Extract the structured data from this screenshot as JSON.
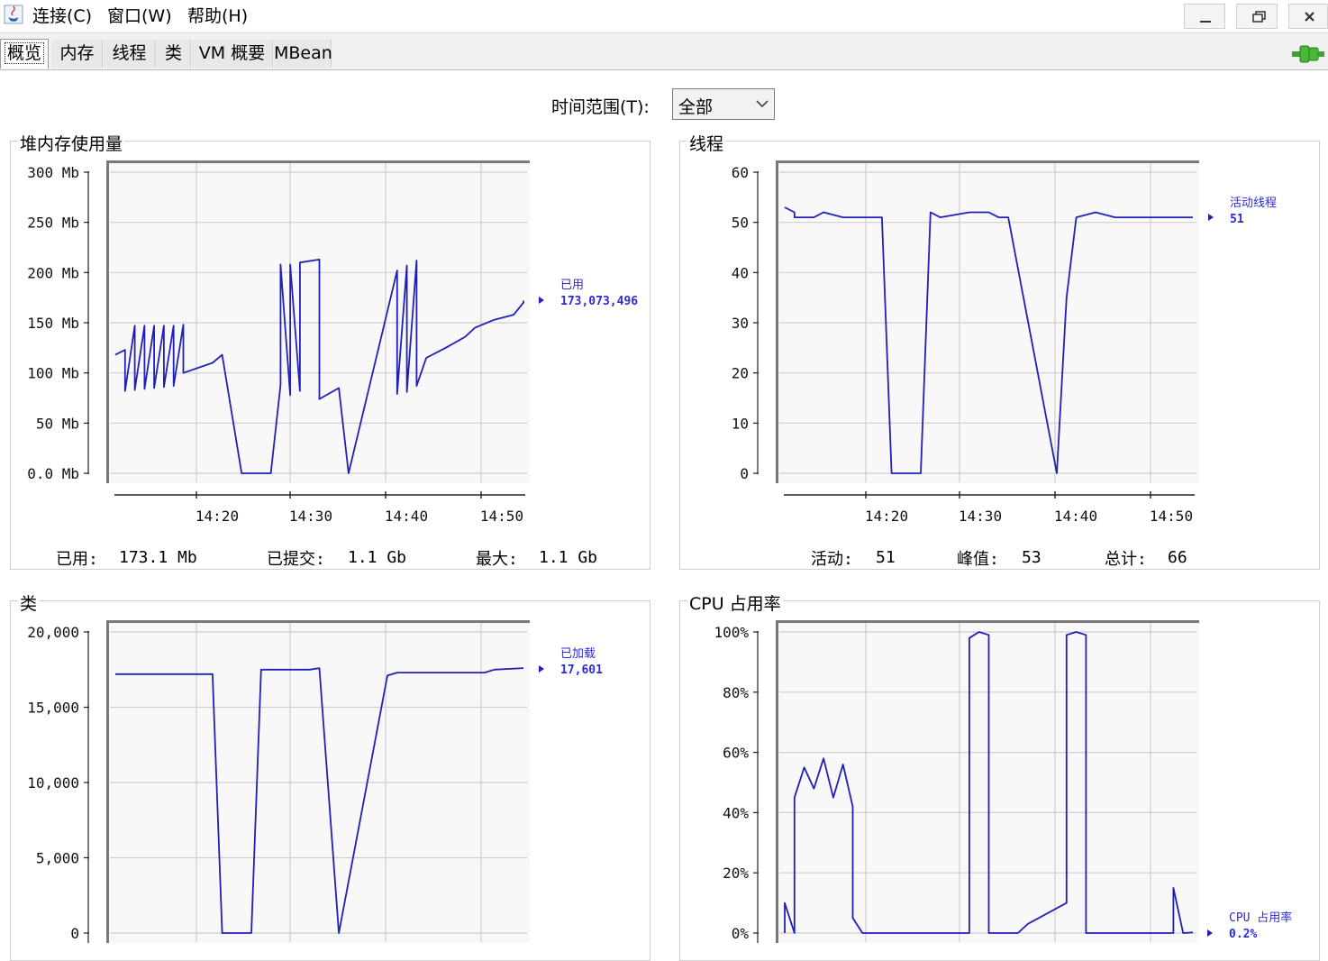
{
  "menu": {
    "connect": "连接(C)",
    "window": "窗口(W)",
    "help": "帮助(H)"
  },
  "tabs": [
    "概览",
    "内存",
    "线程",
    "类",
    "VM 概要",
    "MBean"
  ],
  "time_range": {
    "label": "时间范围(T):",
    "value": "全部"
  },
  "panels": {
    "heap": {
      "title": "堆内存使用量",
      "legend": {
        "name": "已用",
        "value": "173,073,496"
      },
      "stats": {
        "used_label": "已用:",
        "used_value": "173.1 Mb",
        "committed_label": "已提交:",
        "committed_value": "1.1 Gb",
        "max_label": "最大:",
        "max_value": "1.1 Gb"
      }
    },
    "threads": {
      "title": "线程",
      "legend": {
        "name": "活动线程",
        "value": "51"
      },
      "stats": {
        "live_label": "活动:",
        "live_value": "51",
        "peak_label": "峰值:",
        "peak_value": "53",
        "total_label": "总计:",
        "total_value": "66"
      }
    },
    "classes": {
      "title": "类",
      "legend": {
        "name": "已加载",
        "value": "17,601"
      }
    },
    "cpu": {
      "title": "CPU 占用率",
      "legend": {
        "name": "CPU 占用率",
        "value": "0.2%"
      }
    }
  },
  "chart_data": [
    {
      "type": "line",
      "title": "堆内存使用量",
      "ylim": [
        0,
        300
      ],
      "yticks": [
        "0.0 Mb",
        "50 Mb",
        "100 Mb",
        "150 Mb",
        "200 Mb",
        "250 Mb",
        "300 Mb"
      ],
      "xticks": [
        "14:20",
        "14:30",
        "14:40",
        "14:50"
      ],
      "series": [
        {
          "name": "已用",
          "points": [
            [
              "14:11",
              118
            ],
            [
              "14:12",
              123
            ],
            [
              "14:12",
              82
            ],
            [
              "14:13",
              147
            ],
            [
              "14:13",
              83
            ],
            [
              "14:14",
              147
            ],
            [
              "14:14",
              84
            ],
            [
              "14:15",
              147
            ],
            [
              "14:15",
              85
            ],
            [
              "14:16",
              147
            ],
            [
              "14:16",
              86
            ],
            [
              "14:17",
              147
            ],
            [
              "14:17",
              87
            ],
            [
              "14:18",
              148
            ],
            [
              "14:18",
              100
            ],
            [
              "14:21",
              110
            ],
            [
              "14:22",
              118
            ],
            [
              "14:24",
              0
            ],
            [
              "14:27",
              0
            ],
            [
              "14:28",
              88
            ],
            [
              "14:28",
              208
            ],
            [
              "14:29",
              78
            ],
            [
              "14:29",
              208
            ],
            [
              "14:30",
              82
            ],
            [
              "14:30",
              210
            ],
            [
              "14:32",
              213
            ],
            [
              "14:32",
              74
            ],
            [
              "14:34",
              85
            ],
            [
              "14:35",
              0
            ],
            [
              "14:40",
              202
            ],
            [
              "14:40",
              79
            ],
            [
              "14:41",
              207
            ],
            [
              "14:41",
              81
            ],
            [
              "14:42",
              212
            ],
            [
              "14:42",
              87
            ],
            [
              "14:43",
              115
            ],
            [
              "14:45",
              125
            ],
            [
              "14:47",
              136
            ],
            [
              "14:48",
              145
            ],
            [
              "14:50",
              153
            ],
            [
              "14:52",
              158
            ],
            [
              "14:53",
              170
            ],
            [
              "14:53",
              172
            ]
          ]
        }
      ]
    },
    {
      "type": "line",
      "title": "线程",
      "ylim": [
        0,
        60
      ],
      "yticks": [
        "0",
        "10",
        "20",
        "30",
        "40",
        "50",
        "60"
      ],
      "xticks": [
        "14:20",
        "14:30",
        "14:40",
        "14:50"
      ],
      "series": [
        {
          "name": "活动线程",
          "points": [
            [
              "14:11",
              53
            ],
            [
              "14:12",
              52
            ],
            [
              "14:12",
              51
            ],
            [
              "14:14",
              51
            ],
            [
              "14:15",
              52
            ],
            [
              "14:17",
              51
            ],
            [
              "14:21",
              51
            ],
            [
              "14:22",
              0
            ],
            [
              "14:25",
              0
            ],
            [
              "14:26",
              52
            ],
            [
              "14:27",
              51
            ],
            [
              "14:30",
              52
            ],
            [
              "14:32",
              52
            ],
            [
              "14:33",
              51
            ],
            [
              "14:34",
              51
            ],
            [
              "14:39",
              0
            ],
            [
              "14:40",
              35
            ],
            [
              "14:41",
              51
            ],
            [
              "14:43",
              52
            ],
            [
              "14:45",
              51
            ],
            [
              "14:53",
              51
            ]
          ]
        }
      ]
    },
    {
      "type": "line",
      "title": "类",
      "ylim": [
        0,
        20000
      ],
      "yticks": [
        "0",
        "5,000",
        "10,000",
        "15,000",
        "20,000"
      ],
      "xticks": [
        "14:20",
        "14:30",
        "14:40",
        "14:50"
      ],
      "series": [
        {
          "name": "已加载",
          "points": [
            [
              "14:11",
              17200
            ],
            [
              "14:21",
              17200
            ],
            [
              "14:22",
              0
            ],
            [
              "14:25",
              0
            ],
            [
              "14:26",
              17500
            ],
            [
              "14:31",
              17500
            ],
            [
              "14:32",
              17600
            ],
            [
              "14:34",
              0
            ],
            [
              "14:39",
              17100
            ],
            [
              "14:40",
              17300
            ],
            [
              "14:49",
              17300
            ],
            [
              "14:50",
              17500
            ],
            [
              "14:53",
              17601
            ]
          ]
        }
      ]
    },
    {
      "type": "line",
      "title": "CPU 占用率",
      "ylim": [
        0,
        100
      ],
      "yticks": [
        "0%",
        "20%",
        "40%",
        "60%",
        "80%",
        "100%"
      ],
      "series": [
        {
          "name": "CPU 占用率",
          "points": [
            [
              "14:11",
              0
            ],
            [
              "14:11",
              10
            ],
            [
              "14:12",
              0
            ],
            [
              "14:12",
              45
            ],
            [
              "14:13",
              55
            ],
            [
              "14:14",
              48
            ],
            [
              "14:15",
              58
            ],
            [
              "14:16",
              45
            ],
            [
              "14:17",
              56
            ],
            [
              "14:18",
              42
            ],
            [
              "14:18",
              5
            ],
            [
              "14:19",
              0
            ],
            [
              "14:30",
              0
            ],
            [
              "14:30",
              98
            ],
            [
              "14:31",
              100
            ],
            [
              "14:32",
              99
            ],
            [
              "14:32",
              0
            ],
            [
              "14:35",
              0
            ],
            [
              "14:36",
              3
            ],
            [
              "14:40",
              10
            ],
            [
              "14:40",
              99
            ],
            [
              "14:41",
              100
            ],
            [
              "14:42",
              99
            ],
            [
              "14:42",
              0
            ],
            [
              "14:51",
              0
            ],
            [
              "14:51",
              15
            ],
            [
              "14:52",
              0
            ],
            [
              "14:53",
              0.2
            ]
          ]
        }
      ]
    }
  ]
}
